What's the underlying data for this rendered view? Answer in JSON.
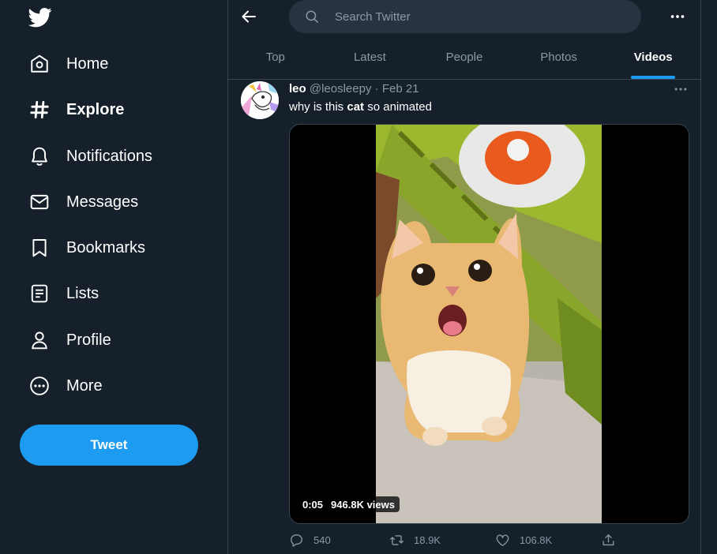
{
  "sidebar": {
    "logo": "twitter-bird-icon",
    "items": [
      {
        "label": "Home",
        "icon": "home-icon"
      },
      {
        "label": "Explore",
        "icon": "hashtag-icon",
        "active": true
      },
      {
        "label": "Notifications",
        "icon": "bell-icon"
      },
      {
        "label": "Messages",
        "icon": "envelope-icon"
      },
      {
        "label": "Bookmarks",
        "icon": "bookmark-icon"
      },
      {
        "label": "Lists",
        "icon": "list-icon"
      },
      {
        "label": "Profile",
        "icon": "person-icon"
      },
      {
        "label": "More",
        "icon": "more-circle-icon"
      }
    ],
    "tweet_button": "Tweet"
  },
  "header": {
    "search_placeholder": "Search Twitter",
    "tabs": [
      {
        "label": "Top"
      },
      {
        "label": "Latest"
      },
      {
        "label": "People"
      },
      {
        "label": "Photos"
      },
      {
        "label": "Videos",
        "active": true
      }
    ]
  },
  "tweet": {
    "name": "leo",
    "handle": "@leosleepy",
    "separator": "·",
    "date": "Feb 21",
    "text_before": "why is this ",
    "text_bold": "cat",
    "text_after": " so animated",
    "video": {
      "duration": "0:05",
      "views": "946.8K views"
    },
    "actions": {
      "replies": "540",
      "retweets": "18.9K",
      "likes": "106.8K"
    }
  },
  "colors": {
    "background": "#15202b",
    "accent": "#1d9bf0",
    "muted_text": "#8b98a5",
    "border": "#38444d"
  }
}
